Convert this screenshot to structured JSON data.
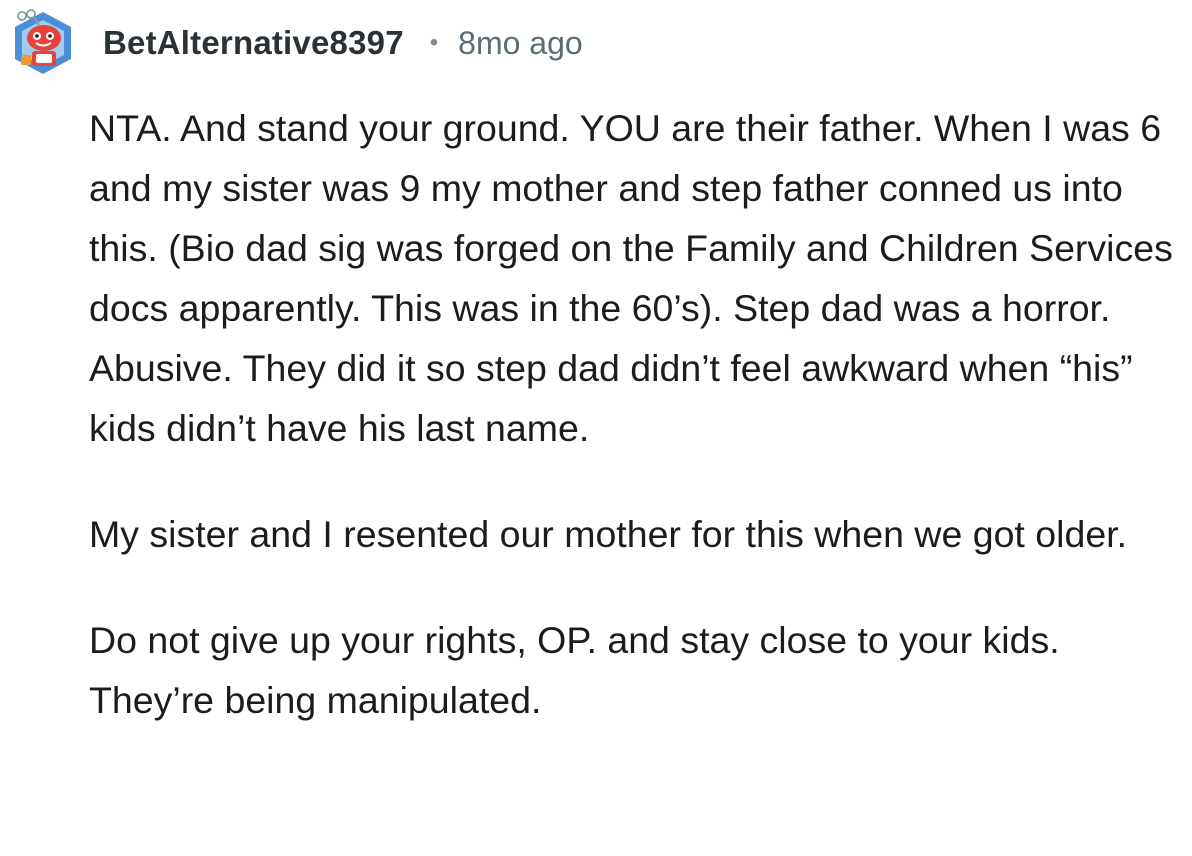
{
  "comment": {
    "avatar_icon": "snoo-avatar-icon",
    "username": "BetAlternative8397",
    "separator": "•",
    "timestamp": "8mo ago",
    "paragraphs": [
      "NTA. And stand your ground. YOU are their father. When I was 6 and my sister was 9 my mother and step father conned us into this. (Bio dad sig was forged on the Family and Children Services docs apparently. This was in the 60’s). Step dad was a horror. Abusive. They did it so step dad didn’t feel awkward when “his” kids didn’t have his last name.",
      "My sister and I resented our mother for this when we got older.",
      "Do not give up your rights, OP. and stay close to your kids. They’re being manipulated."
    ]
  },
  "colors": {
    "background": "#ffffff",
    "text": "#1c1c1c",
    "username": "#2a3236",
    "meta": "#5c6c74",
    "avatar_red": "#e8423a",
    "avatar_blue": "#3d7fc4"
  }
}
